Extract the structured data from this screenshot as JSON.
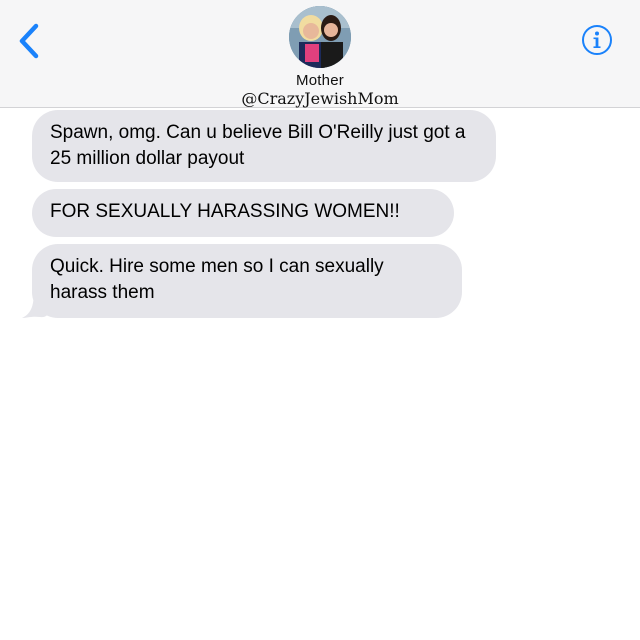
{
  "contact": {
    "name": "Mother",
    "watermark": "@CrazyJewishMom"
  },
  "colors": {
    "accent": "#1a82fb",
    "bubble_received": "#e5e5ea",
    "header_bg": "#f6f6f7"
  },
  "icons": {
    "back": "chevron-left-icon",
    "info": "info-circle-icon"
  },
  "messages": [
    {
      "from": "contact",
      "text": "Spawn, omg. Can u believe Bill O'Reilly just got a 25 million dollar payout"
    },
    {
      "from": "contact",
      "text": "FOR SEXUALLY HARASSING WOMEN!!"
    },
    {
      "from": "contact",
      "text": "Quick. Hire some men so I can sexually harass them"
    }
  ]
}
